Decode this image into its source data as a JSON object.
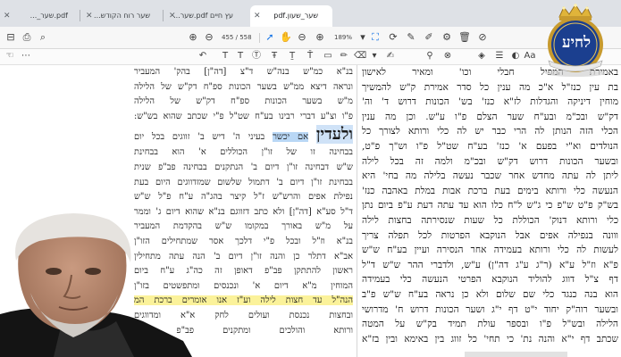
{
  "browser": {
    "tabs": [
      {
        "title": "עץ חיים pdf.שער...",
        "active": false
      },
      {
        "title": "שער רוח הקודש...",
        "active": false
      },
      {
        "title": "pdf.שער_...",
        "active": false
      },
      {
        "title": "שער_שעון.pdf",
        "active": true
      }
    ]
  },
  "pdf_toolbar": {
    "page_current": "455",
    "page_total": "/ 558",
    "zoom": "189%"
  },
  "logo": {
    "text": "לחיע"
  },
  "document": {
    "left_column": {
      "lines": [
        "בנ\"א כמ\"ש בנה\"ש ד\"צ [דה\"ן] בהק' המעביר",
        "ונראה דיצא ממ\"ש בשער הכונות ספ\"ח דק\"ש של הלילה",
        "מ\"ש בשער הכונות ספ\"ח דק\"ש של הלילה",
        "פ\"ו וצ\"ע דברי רבינו בע\"ח שט\"ל פ\"י שכתב שהוא בש\"ש:"
      ],
      "header_prefix": "ולעדין",
      "header_highlight": "אם יכשר",
      "header_rest": "בעיני ה' דיש ב' זווגים בכל יום",
      "body_lines": [
        "בבחינה זו של זו\"ן הכוללים א' הוא בבחינת",
        "ש\"ש דבחינה זו\"ן דיום ב' הנתקנים בבחינה פב\"פ שנית",
        "בבחינת זו\"ן דיום ב' דתמול שלשום שמזדווגים היום בעת",
        "נפילת אפים והרש\"ש ז\"ל קיצר בהג\"ה ע\"ח פ\"ל ש\"ש",
        "ד\"ל סע\"א [דה\"ן] ולא כתב דזווגם בנ\"א שהוא דיום ג' וממר",
        "על מ\"ש באורך במקומו ש\"ש בהקדמת המעביר",
        "בנ\"א וז\"ל ובכל פ\"י דלכך אסר שמתחילים הזו\"ן",
        "אב\"א דתלר כן והנה זו\"ן דיום ב' הנה עתה מתחילין",
        "ראשון להתתקן פב\"פ דאופן זה כה\"ג ע\"ח ביום",
        "המוחין מ\"א דיום א' ונכנסים ומתפשטים בזו\"ן"
      ],
      "highlight_line": "הנה\"ל עד חצות לילה וע\"ז אנו אומרים ברכת המ",
      "tail_lines": [
        "ובחצות נכנסת ועולים לחק א\"א ומדווגים",
        "ורותא והולכים ומתקנים פב\"פ לפני"
      ]
    },
    "right_column": {
      "lines": [
        "באמירת המפיל חבלי וכו' ומאיר לאישון",
        "בת עין כנז\"ל א\"כ מה ענין כל סדר אמירת ק\"ש להמשיך",
        "מוחין דיניקה והגדלות לז\"א כנז' בש' הכונות דרוש ד' וה'",
        "דק\"ש ובכ\"מ ובע\"ח שער הצלם פ\"ו ע\"ש. וכן מה ענין",
        "הכלי הזה הנותן לה הרי כבר יש לה כלי ורותא לצורך כל",
        "הנולדים וא\"י בפעם א' כנז' בע\"ח שט\"ל פ\"ו וש\"ך פ\"ט,",
        "ובשער הכונות דרוש דק\"ש ובכ\"מ ולמה זה בכל לילה",
        "ליתן לה עתה מחדש אחר שכבר נעשה בלילה מה בחי' היא",
        "הנעשה כלי ורותא בימים בעת ברכת אבות במלת באהבה כנז'",
        "בש\"ק פ\"ט ש\"פ כי ג\"ש ל\"ח כלו הוא עד עתה דעת ע\"פ ביום נתן",
        "כלי ורותא דנוק' הכוללת כל שעות שנסירתה בחצות לילה",
        "ווונה בנפילה אפים אבל הנוקבא הפרטות לכל תפלה צריך",
        "לעשות לה כלי ורותא בעמידה אחר הנסירה ועיין בע\"ח ש\"ש",
        "פ\"א וז\"ל ע\"א (ר\"ג ע\"ג דה\"ן) ע\"ש, ולדברי ההר ש\"ש ד\"ל",
        "דף צ\"ל דווג להוליד הנוקבא הפרטי הנעשה כלי בעמידה",
        "הוא בנה כנגד כלי שם שלום ולא כן נראה בע\"ח ש\"ש פ\"ב",
        "ובשער רוה\"ק יחוד י\"ט דף י\"ג ושער הכונות דרוש ח' מדרושי",
        "הלילה ובש\"ל פ\"ו ובספר עולת תמיד בק\"ש על המטה",
        "שכתב דף י\"א והנה נת' כי תחי' כל זווג בין באימא ובין בז\"א"
      ]
    }
  }
}
